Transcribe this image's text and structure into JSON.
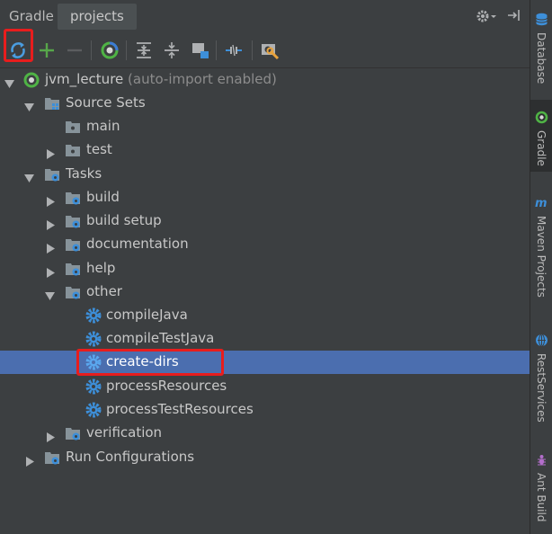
{
  "header": {
    "title": "Gradle",
    "tab_projects": "projects"
  },
  "toolbar": {
    "buttons": [
      "refresh-all",
      "add",
      "remove",
      "execute-task",
      "expand-all",
      "collapse-all",
      "group-modules",
      "toggle-offline",
      "settings"
    ]
  },
  "tree": {
    "root_name": "jvm_lecture",
    "root_note": "(auto-import enabled)",
    "source_sets": "Source Sets",
    "main": "main",
    "test": "test",
    "tasks": "Tasks",
    "build": "build",
    "build_setup": "build setup",
    "documentation": "documentation",
    "help": "help",
    "other": "other",
    "compile_java": "compileJava",
    "compile_test_java": "compileTestJava",
    "create_dirs": "create-dirs",
    "process_resources": "processResources",
    "process_test_resources": "processTestResources",
    "verification": "verification",
    "run_configurations": "Run Configurations"
  },
  "side_tabs": {
    "database": "Database",
    "gradle": "Gradle",
    "maven": "Maven Projects",
    "rest": "RestServices",
    "ant": "Ant Build"
  },
  "colors": {
    "selection": "#4b6eaf",
    "highlight": "#e81d1d",
    "gradle_green": "#4fb345",
    "gear_blue": "#3d8fd9"
  }
}
